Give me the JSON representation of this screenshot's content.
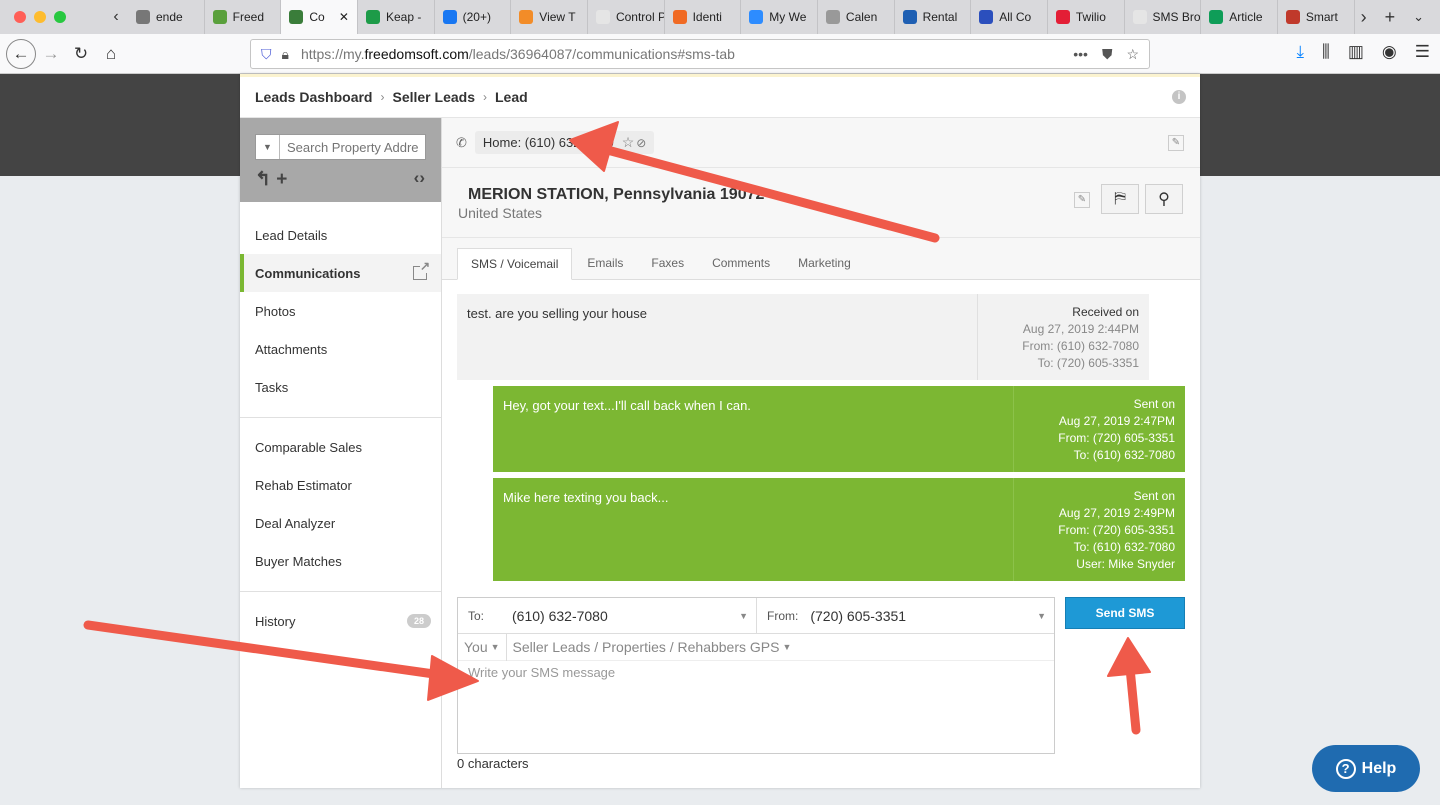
{
  "browser": {
    "tabs": [
      {
        "label": "ende",
        "color": "#777"
      },
      {
        "label": "Freed",
        "color": "#5aa03c"
      },
      {
        "label": "Co",
        "color": "#3a7d3a",
        "active": true
      },
      {
        "label": "Keap -",
        "color": "#1d9b48"
      },
      {
        "label": "(20+)",
        "color": "#1877f2"
      },
      {
        "label": "View T",
        "color": "#f28c28"
      },
      {
        "label": "Control Pa",
        "color": "#e5e5e5"
      },
      {
        "label": "Identi",
        "color": "#f06a24"
      },
      {
        "label": "My We",
        "color": "#2d8cff"
      },
      {
        "label": "Calen",
        "color": "#999"
      },
      {
        "label": "Rental",
        "color": "#1e5fb3"
      },
      {
        "label": "All Co",
        "color": "#2b4fbd"
      },
      {
        "label": "Twilio",
        "color": "#e31e36"
      },
      {
        "label": "SMS Broa",
        "color": "#e5e5e5"
      },
      {
        "label": "Article",
        "color": "#0f9d58"
      },
      {
        "label": "Smart",
        "color": "#c0392b"
      }
    ],
    "url_prefix": "https://my.",
    "url_domain": "freedomsoft.com",
    "url_path": "/leads/36964087/communications#sms-tab",
    "url_dots": "•••"
  },
  "breadcrumb": {
    "items": [
      "Leads Dashboard",
      "Seller Leads",
      "Lead"
    ],
    "sep": "›"
  },
  "sidebar": {
    "search_placeholder": "Search Property Address",
    "items_top": [
      "Lead Details",
      "Communications",
      "Photos",
      "Attachments",
      "Tasks"
    ],
    "items_mid": [
      "Comparable Sales",
      "Rehab Estimator",
      "Deal Analyzer",
      "Buyer Matches"
    ],
    "history_label": "History",
    "history_count": "28"
  },
  "lead": {
    "phone": "Home: (610) 632-7080",
    "address_line1": "MERION STATION, Pennsylvania 19072",
    "address_line2": "United States"
  },
  "tabs": [
    "SMS / Voicemail",
    "Emails",
    "Faxes",
    "Comments",
    "Marketing"
  ],
  "messages": [
    {
      "text": "test. are you selling your house",
      "head": "Received on",
      "date": "Aug 27, 2019 2:44PM",
      "from": "From: (610) 632-7080",
      "to": "To: (720) 605-3351"
    },
    {
      "text": "Hey, got your text...I'll call back when I can.",
      "head": "Sent on",
      "date": "Aug 27, 2019 2:47PM",
      "from": "From: (720) 605-3351",
      "to": "To: (610) 632-7080"
    },
    {
      "text": "Mike here texting you back...",
      "head": "Sent on",
      "date": "Aug 27, 2019 2:49PM",
      "from": "From: (720) 605-3351",
      "to": "To: (610) 632-7080",
      "user": "User: Mike Snyder"
    }
  ],
  "composer": {
    "to_label": "To:",
    "to_value": "(610) 632-7080",
    "from_label": "From:",
    "from_value": "(720) 605-3351",
    "sender": "You",
    "template": "Seller Leads / Properties / Rehabbers GPS",
    "placeholder": "Write your SMS message",
    "char_count": "0 characters",
    "send_label": "Send SMS"
  },
  "help_label": "Help"
}
